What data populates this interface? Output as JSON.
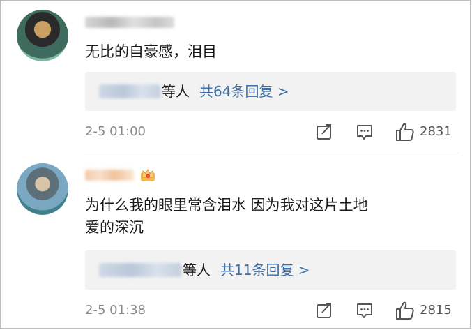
{
  "comments": [
    {
      "text": "无比的自豪感，泪目",
      "reply_summary": {
        "suffix": "等人",
        "link": "共64条回复 >"
      },
      "timestamp": "2-5 01:00",
      "likes": "2831"
    },
    {
      "text_lines": [
        "为什么我的眼里常含泪水 因为我对这片土地",
        "爱的深沉"
      ],
      "reply_summary": {
        "suffix": "等人",
        "link": "共11条回复 >"
      },
      "timestamp": "2-5 01:38",
      "likes": "2815"
    }
  ],
  "colors": {
    "link": "#3d6ea5",
    "text": "#1a1a1a",
    "meta": "#8a8a8a",
    "reply_bg": "#f2f2f2"
  },
  "icons": [
    "share-icon",
    "comment-icon",
    "thumbs-up-icon",
    "crown-badge-icon"
  ]
}
